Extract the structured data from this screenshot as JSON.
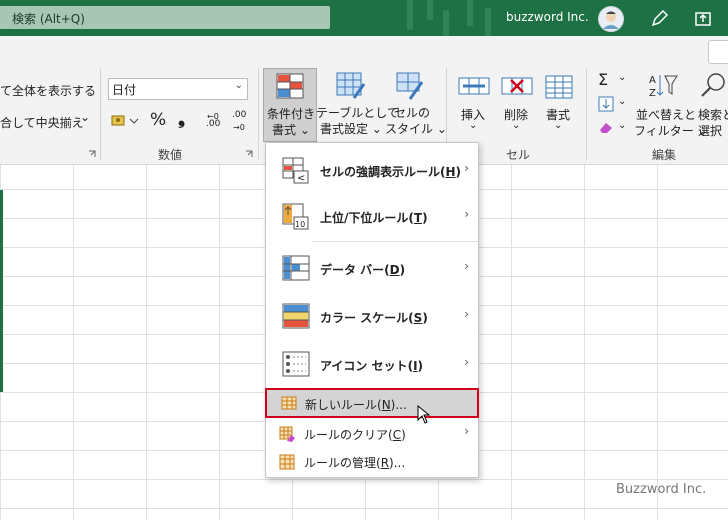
{
  "titlebar": {
    "search_text": "検索 (Alt+Q)",
    "user_name": "buzzword Inc."
  },
  "ribbon": {
    "align": {
      "wrap_label": "て全体を表示する",
      "merge_label": "合して中央揃え",
      "merge_arrow": "⌄"
    },
    "number": {
      "format_value": "日付",
      "percent": "%",
      "comma": "❟",
      "dec_inc": ".00",
      "dec_dec": ".00",
      "group_label": "数値"
    },
    "styles": {
      "cond_format_l1": "条件付き",
      "cond_format_l2": "書式 ⌄",
      "table_format_l1": "テーブルとして",
      "table_format_l2": "書式設定 ⌄",
      "cell_style_l1": "セルの",
      "cell_style_l2": "スタイル ⌄"
    },
    "cells": {
      "insert": "挿入",
      "delete": "削除",
      "format": "書式",
      "group_label": "セル"
    },
    "editing": {
      "sigma": "Σ",
      "sort_l1": "並べ替えと",
      "sort_l2": "フィルター ⌄",
      "find_l1": "検索と",
      "find_l2": "選択 ⌄",
      "group_label": "編集"
    }
  },
  "menu": {
    "items": [
      {
        "label": "セルの強調表示ルール(",
        "key": "H",
        "tail": ")",
        "arrow": "›"
      },
      {
        "label": "上位/下位ルール(",
        "key": "T",
        "tail": ")",
        "arrow": "›"
      },
      {
        "label": "データ バー(",
        "key": "D",
        "tail": ")",
        "arrow": "›"
      },
      {
        "label": "カラー スケール(",
        "key": "S",
        "tail": ")",
        "arrow": "›"
      },
      {
        "label": "アイコン セット(",
        "key": "I",
        "tail": ")",
        "arrow": "›"
      },
      {
        "label": "新しいルール(",
        "key": "N",
        "tail": ")...",
        "arrow": ""
      },
      {
        "label": "ルールのクリア(",
        "key": "C",
        "tail": ")",
        "arrow": "›"
      },
      {
        "label": "ルールの管理(",
        "key": "R",
        "tail": ")...",
        "arrow": ""
      }
    ]
  },
  "watermark": "Buzzword Inc.",
  "colors": {
    "brand": "#1e7145",
    "highlight_border": "#d0021b"
  }
}
